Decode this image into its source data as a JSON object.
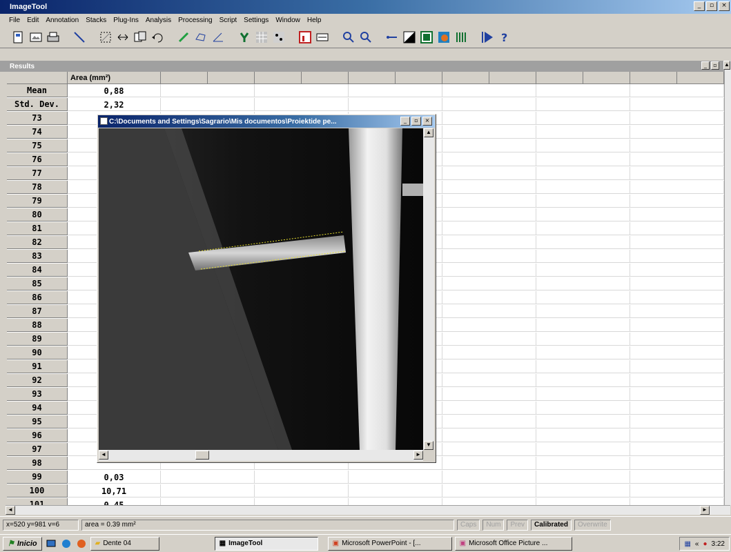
{
  "app": {
    "title": "ImageTool"
  },
  "menu": [
    "File",
    "Edit",
    "Annotation",
    "Stacks",
    "Plug-Ins",
    "Analysis",
    "Processing",
    "Script",
    "Settings",
    "Window",
    "Help"
  ],
  "toolbar_icons": [
    "new-icon",
    "open-icon",
    "print-icon",
    "line-tool-icon",
    "select-icon",
    "crop-icon",
    "copy-icon",
    "undo-icon",
    "pencil-icon",
    "polygon-icon",
    "angle-icon",
    "spray-icon",
    "grid-icon",
    "filter-icon",
    "histogram-icon",
    "display-icon",
    "zoom-in-icon",
    "zoom-out-icon",
    "calibrate-icon",
    "contrast-icon",
    "table-icon",
    "color-icon",
    "bars-icon",
    "run-icon",
    "help-icon"
  ],
  "results": {
    "title": "Results",
    "column_header": "Area (mm²)",
    "summary": [
      {
        "label": "Mean",
        "value": "0,88"
      },
      {
        "label": "Std. Dev.",
        "value": "2,32"
      }
    ],
    "rows": [
      {
        "label": "73",
        "value": ""
      },
      {
        "label": "74",
        "value": ""
      },
      {
        "label": "75",
        "value": ""
      },
      {
        "label": "76",
        "value": ""
      },
      {
        "label": "77",
        "value": ""
      },
      {
        "label": "78",
        "value": ""
      },
      {
        "label": "79",
        "value": ""
      },
      {
        "label": "80",
        "value": ""
      },
      {
        "label": "81",
        "value": ""
      },
      {
        "label": "82",
        "value": ""
      },
      {
        "label": "83",
        "value": ""
      },
      {
        "label": "84",
        "value": ""
      },
      {
        "label": "85",
        "value": ""
      },
      {
        "label": "86",
        "value": ""
      },
      {
        "label": "87",
        "value": ""
      },
      {
        "label": "88",
        "value": ""
      },
      {
        "label": "89",
        "value": ""
      },
      {
        "label": "90",
        "value": ""
      },
      {
        "label": "91",
        "value": ""
      },
      {
        "label": "92",
        "value": ""
      },
      {
        "label": "93",
        "value": ""
      },
      {
        "label": "94",
        "value": ""
      },
      {
        "label": "95",
        "value": ""
      },
      {
        "label": "96",
        "value": ""
      },
      {
        "label": "97",
        "value": ""
      },
      {
        "label": "98",
        "value": ""
      },
      {
        "label": "99",
        "value": "0,03"
      },
      {
        "label": "100",
        "value": "10,71"
      },
      {
        "label": "101",
        "value": "0,45"
      }
    ]
  },
  "image_window": {
    "title": "C:\\Documents and Settings\\Sagrario\\Mis documentos\\Proiektide pe..."
  },
  "status": {
    "coords": "x=520 y=981 v=6",
    "measurement": "area = 0.39 mm²",
    "indicators": [
      {
        "label": "Caps",
        "on": false
      },
      {
        "label": "Num",
        "on": false
      },
      {
        "label": "Prev",
        "on": false
      },
      {
        "label": "Calibrated",
        "on": true
      },
      {
        "label": "Overwrite",
        "on": false
      }
    ]
  },
  "taskbar": {
    "start": "Inicio",
    "tasks": [
      {
        "label": "Dente 04",
        "active": false
      },
      {
        "label": "ImageTool",
        "active": true
      },
      {
        "label": "Microsoft PowerPoint - [...",
        "active": false
      },
      {
        "label": "Microsoft Office Picture ...",
        "active": false
      }
    ],
    "clock": "3:22"
  },
  "colors": {
    "titlebar": "#0a246a",
    "selection_outline": "#e8e030"
  }
}
